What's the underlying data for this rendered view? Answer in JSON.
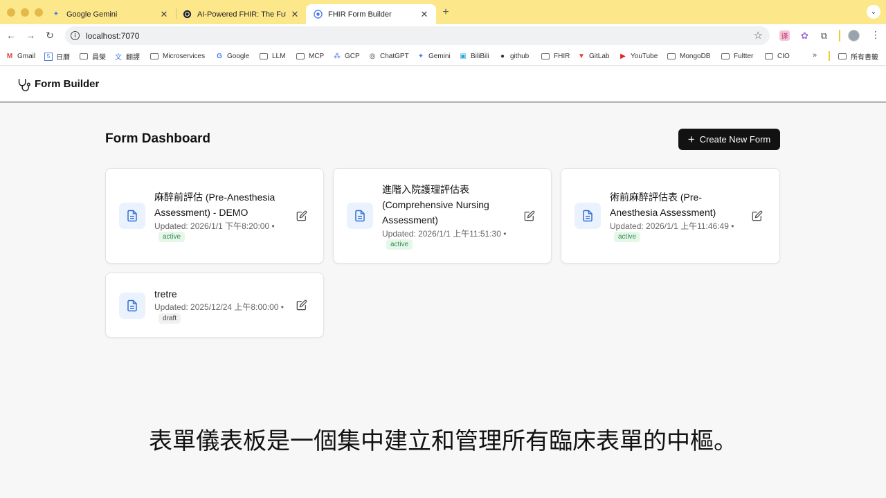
{
  "browser": {
    "tabs": [
      {
        "title": "Google Gemini",
        "icon": "gemini-icon"
      },
      {
        "title": "AI-Powered FHIR: The Future",
        "icon": "chatgpt-icon"
      },
      {
        "title": "FHIR Form Builder",
        "icon": "globe-icon",
        "active": true
      }
    ],
    "url": "localhost:7070",
    "bookmarks": [
      {
        "label": "Gmail",
        "icon": "gmail-icon"
      },
      {
        "label": "日曆",
        "icon": "calendar-icon"
      },
      {
        "label": "員榮",
        "icon": "folder-icon"
      },
      {
        "label": "翻譯",
        "icon": "translate-icon"
      },
      {
        "label": "Microservices",
        "icon": "folder-icon"
      },
      {
        "label": "Google",
        "icon": "google-icon"
      },
      {
        "label": "LLM",
        "icon": "folder-icon"
      },
      {
        "label": "MCP",
        "icon": "folder-icon"
      },
      {
        "label": "GCP",
        "icon": "gcp-icon"
      },
      {
        "label": "ChatGPT",
        "icon": "chatgpt-icon"
      },
      {
        "label": "Gemini",
        "icon": "gemini-icon"
      },
      {
        "label": "BiliBili",
        "icon": "bilibili-icon"
      },
      {
        "label": "github",
        "icon": "github-icon"
      },
      {
        "label": "FHIR",
        "icon": "folder-icon"
      },
      {
        "label": "GitLab",
        "icon": "gitlab-icon"
      },
      {
        "label": "YouTube",
        "icon": "youtube-icon"
      },
      {
        "label": "MongoDB",
        "icon": "folder-icon"
      },
      {
        "label": "Fultter",
        "icon": "folder-icon"
      },
      {
        "label": "CIO",
        "icon": "folder-icon"
      }
    ],
    "bookmarks_more": "»",
    "all_bookmarks": "所有書籤"
  },
  "app": {
    "title": "Form Builder",
    "page_title": "Form Dashboard",
    "create_button": "Create New Form",
    "forms": [
      {
        "title": "麻醉前評估 (Pre-Anesthesia Assessment) - DEMO",
        "updated": "Updated: 2026/1/1 下午8:20:00 •",
        "status": "active"
      },
      {
        "title": "進階入院護理評估表 (Comprehensive Nursing Assessment)",
        "updated": "Updated: 2026/1/1 上午11:51:30 •",
        "status": "active"
      },
      {
        "title": "術前麻醉評估表 (Pre-Anesthesia Assessment)",
        "updated": "Updated: 2026/1/1 上午11:46:49 •",
        "status": "active"
      },
      {
        "title": "tretre",
        "updated": "Updated: 2025/12/24 上午8:00:00 •",
        "status": "draft"
      }
    ]
  },
  "subtitle": "表單儀表板是一個集中建立和管理所有臨床表單的中樞。",
  "colors": {
    "tabstrip": "#fce88a",
    "primary_button": "#121212",
    "doc_icon": "#2f6fd6",
    "active_badge_bg": "#e6f7ea",
    "active_badge_text": "#2f8f4e"
  }
}
